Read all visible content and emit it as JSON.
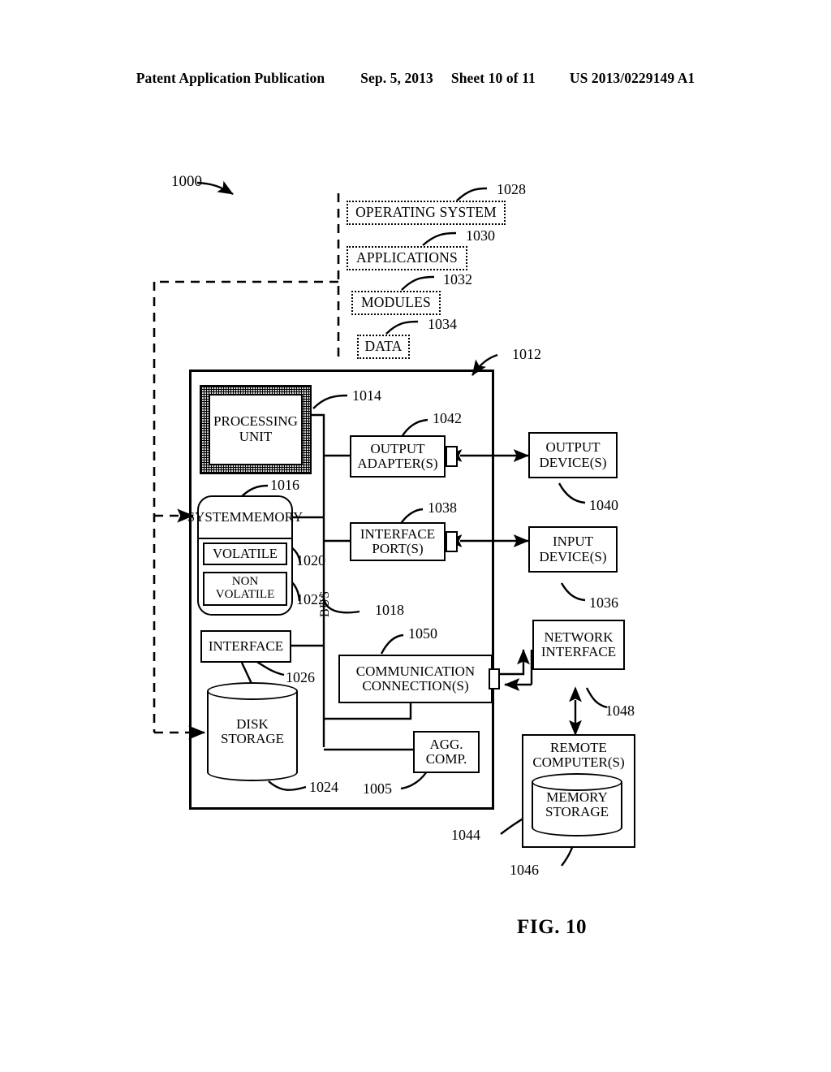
{
  "header": {
    "publication": "Patent Application Publication",
    "date": "Sep. 5, 2013",
    "sheet": "Sheet 10 of 11",
    "docnum": "US 2013/0229149 A1"
  },
  "figure": {
    "caption": "FIG. 10",
    "system_ref": "1000",
    "computer_ref": "1012"
  },
  "software_stack": [
    {
      "label": "OPERATING SYSTEM",
      "ref": "1028"
    },
    {
      "label": "APPLICATIONS",
      "ref": "1030"
    },
    {
      "label": "MODULES",
      "ref": "1032"
    },
    {
      "label": "DATA",
      "ref": "1034"
    }
  ],
  "blocks": {
    "processing_unit": {
      "label": "PROCESSING\nUNIT",
      "line1": "PROCESSING",
      "line2": "UNIT",
      "ref": "1014"
    },
    "system_memory": {
      "line1": "SYSTEM",
      "line2": "MEMORY",
      "ref": "1016"
    },
    "volatile": {
      "label": "VOLATILE",
      "ref": "1020"
    },
    "non_volatile": {
      "line1": "NON",
      "line2": "VOLATILE",
      "ref": "1022"
    },
    "interface": {
      "label": "INTERFACE",
      "ref": "1026"
    },
    "disk_storage": {
      "line1": "DISK",
      "line2": "STORAGE",
      "ref": "1024"
    },
    "bus": {
      "label": "BUS",
      "ref": "1018"
    },
    "output_adapters": {
      "line1": "OUTPUT",
      "line2": "ADAPTER(S)",
      "ref": "1042"
    },
    "interface_ports": {
      "line1": "INTERFACE",
      "line2": "PORT(S)",
      "ref": "1038"
    },
    "comm_connections": {
      "line1": "COMMUNICATION",
      "line2": "CONNECTION(S)",
      "ref": "1050"
    },
    "agg_comp": {
      "line1": "AGG.",
      "line2": "COMP.",
      "ref": "1005"
    },
    "output_devices": {
      "line1": "OUTPUT",
      "line2": "DEVICE(S)",
      "ref": "1040"
    },
    "input_devices": {
      "line1": "INPUT",
      "line2": "DEVICE(S)",
      "ref": "1036"
    },
    "network_interface": {
      "line1": "NETWORK",
      "line2": "INTERFACE",
      "ref": "1048"
    },
    "remote_computers": {
      "line1": "REMOTE",
      "line2": "COMPUTER(S)",
      "ref": "1044"
    },
    "memory_storage": {
      "line1": "MEMORY",
      "line2": "STORAGE",
      "ref": "1046"
    }
  },
  "colors": {
    "ink": "#000000",
    "paper": "#ffffff"
  }
}
